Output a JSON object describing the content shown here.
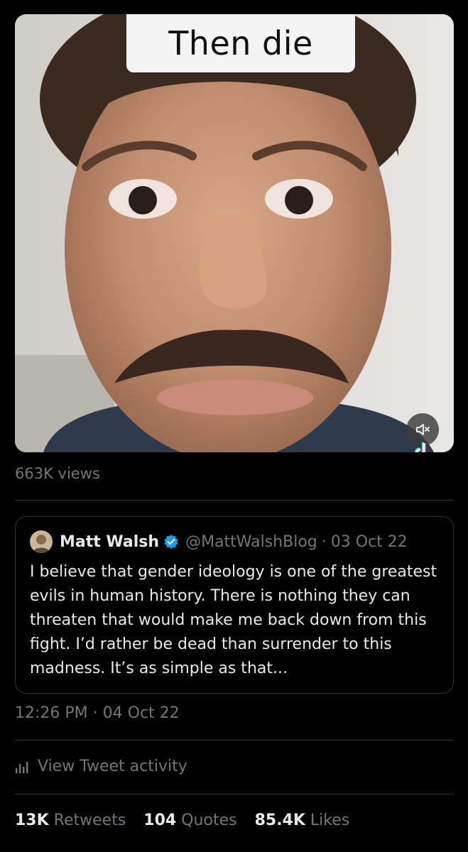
{
  "video": {
    "caption": "Then die",
    "mute_icon": "mute-icon",
    "watermark_icon": "tiktok-icon",
    "views": "663K views"
  },
  "quote": {
    "name": "Matt Walsh",
    "verified_icon": "verified-badge-icon",
    "handle": "@MattWalshBlog",
    "separator": "·",
    "date": "03 Oct 22",
    "text": "I believe that gender ideology is one of the greatest evils in human history. There is nothing they can threaten that would make me back down from this fight. I’d rather be dead than surrender to this madness. It’s as simple as that..."
  },
  "timestamp": {
    "time": "12:26 PM",
    "separator": "·",
    "date": "04 Oct 22"
  },
  "activity": {
    "icon": "bar-chart-icon",
    "label": "View Tweet activity"
  },
  "stats": {
    "retweets_count": "13K",
    "retweets_label": "Retweets",
    "quotes_count": "104",
    "quotes_label": "Quotes",
    "likes_count": "85.4K",
    "likes_label": "Likes"
  },
  "colors": {
    "background": "#000000",
    "text_primary": "#e7e9ea",
    "text_secondary": "#71767b",
    "border": "#2f3336",
    "verified": "#1d9bf0"
  }
}
